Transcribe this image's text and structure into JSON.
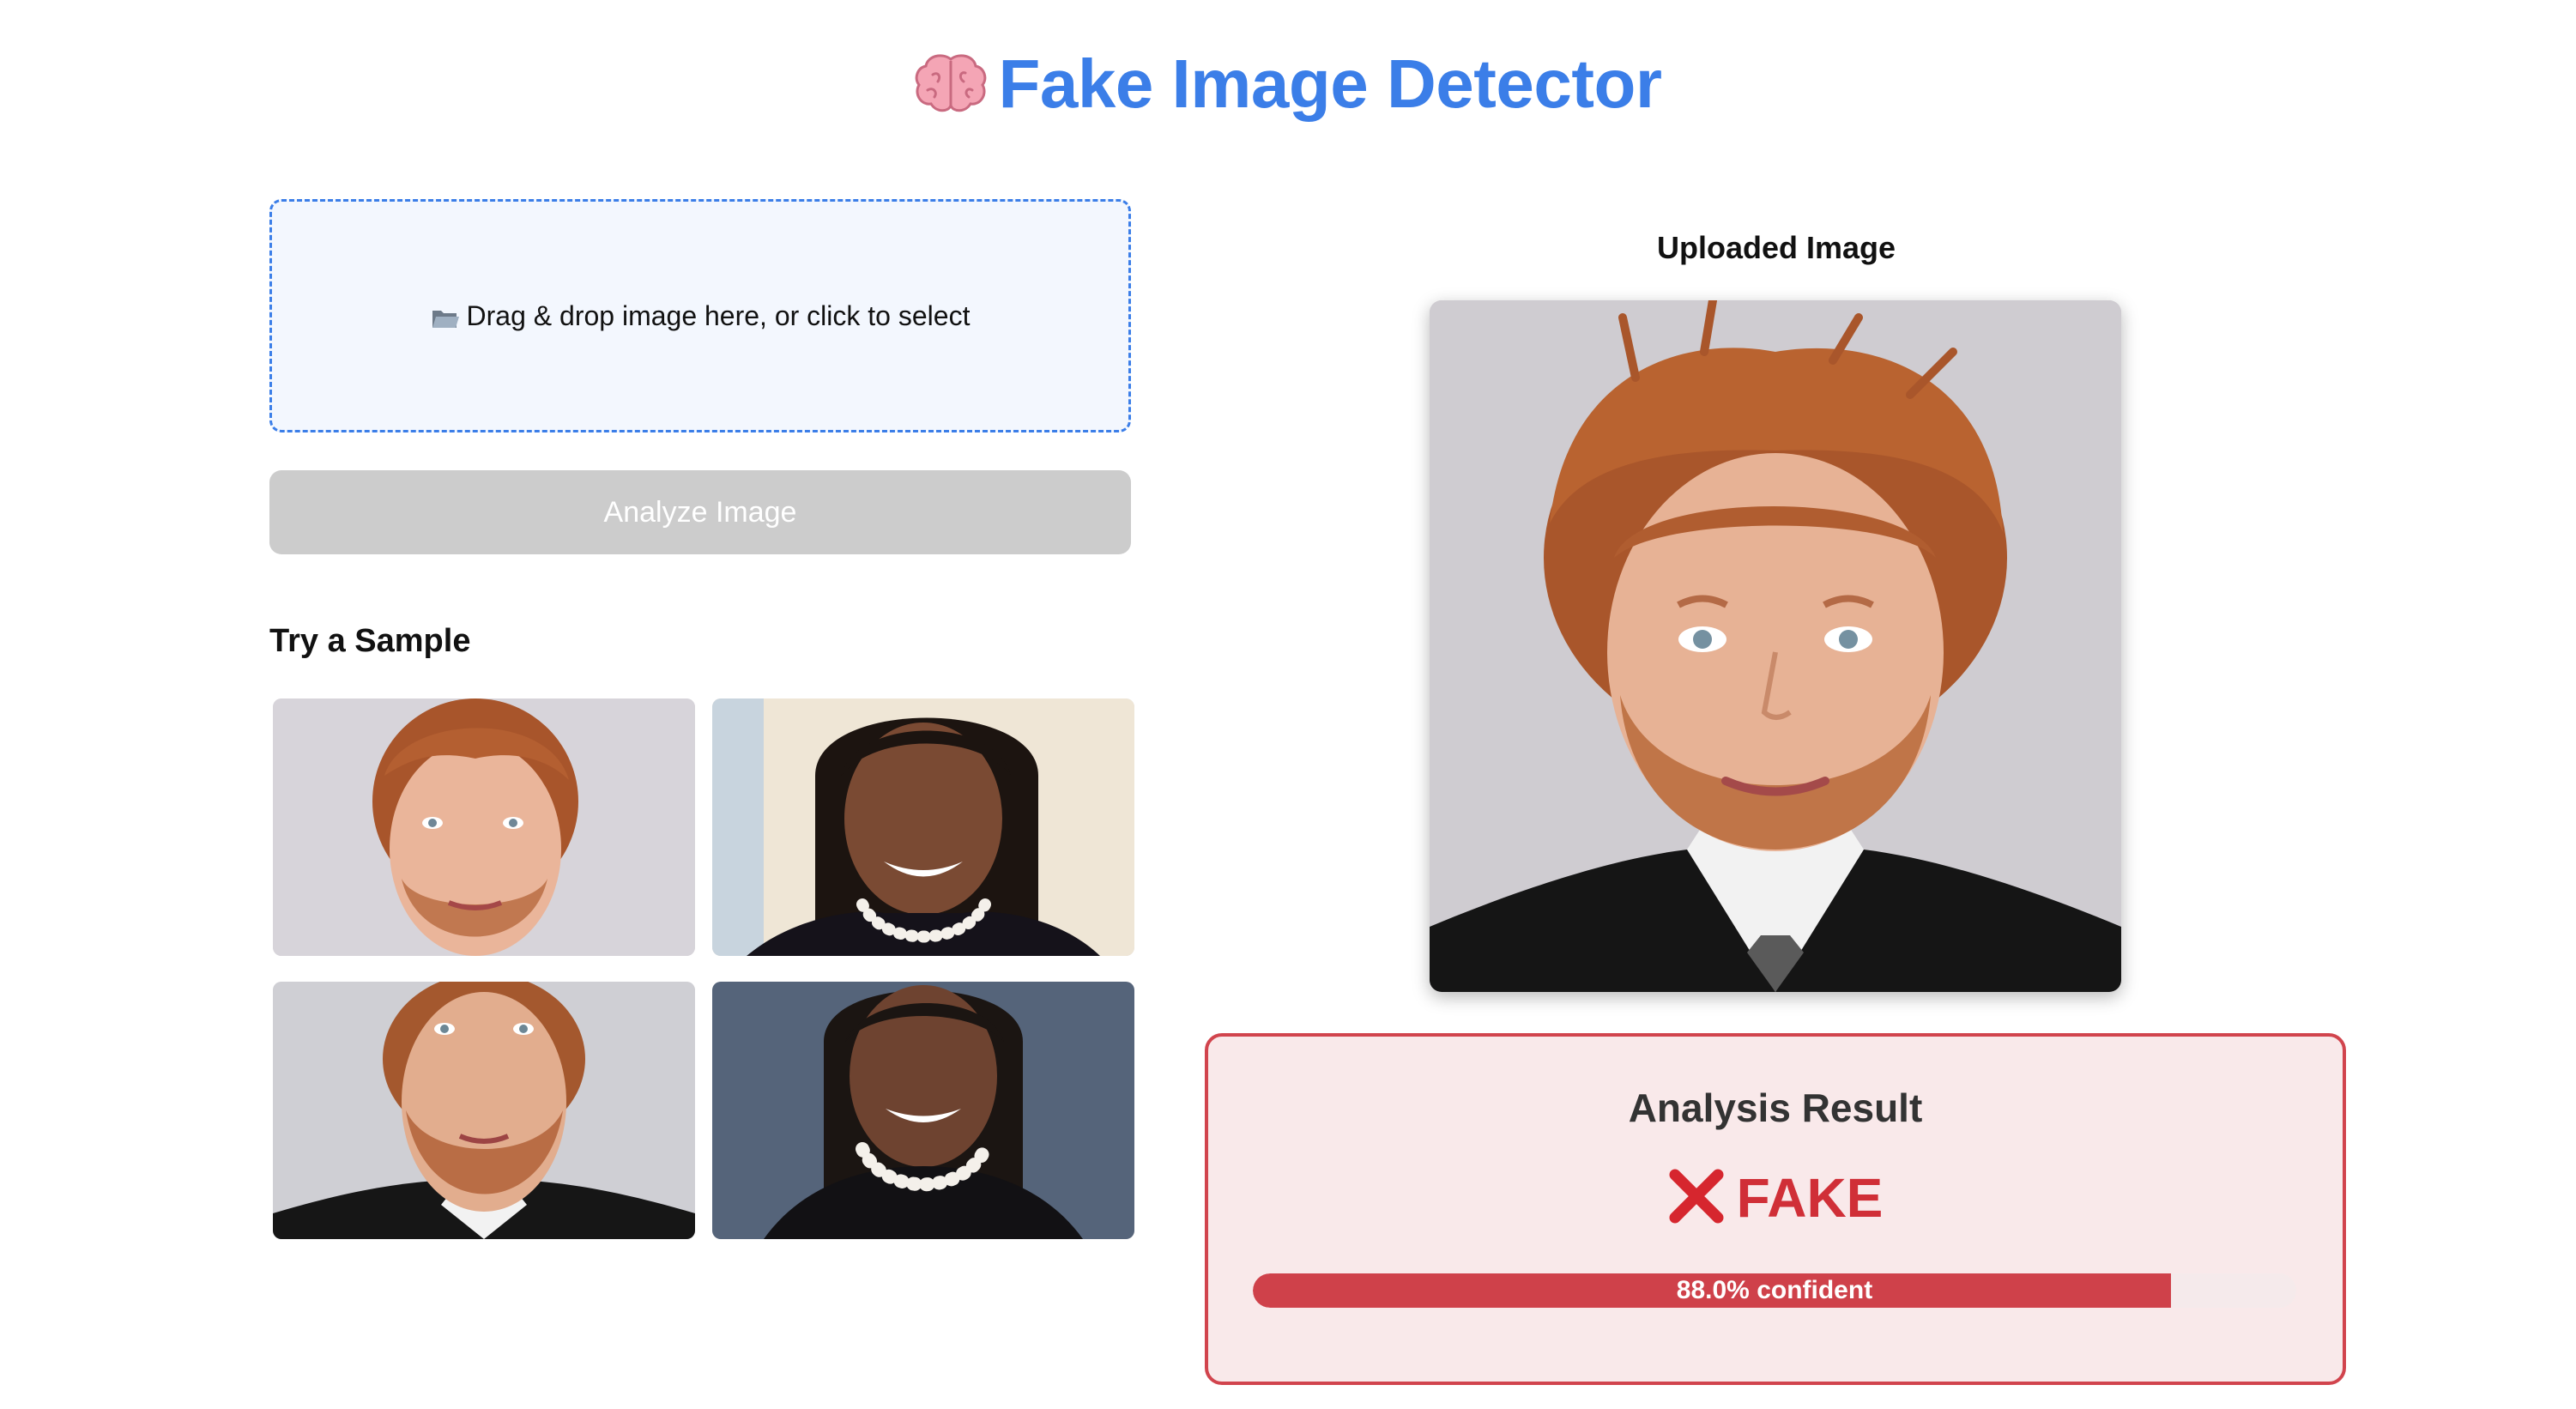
{
  "app": {
    "title_icon": "brain-icon",
    "title": "Fake Image Detector"
  },
  "upload": {
    "dropzone_icon": "folder-icon",
    "dropzone_text": "Drag & drop image here, or click to select",
    "analyze_label": "Analyze Image",
    "analyze_enabled": false
  },
  "samples": {
    "heading": "Try a Sample",
    "items": [
      {
        "subject": "red-haired man portrait",
        "background": "#d7d4da"
      },
      {
        "subject": "woman with pearl necklace portrait",
        "background": "#efe6d6"
      },
      {
        "subject": "red-haired man in suit portrait",
        "background": "#cfcfd4"
      },
      {
        "subject": "woman with pearl necklace portrait",
        "background": "#55647a"
      }
    ]
  },
  "preview": {
    "heading": "Uploaded Image",
    "subject": "red-haired man in suit portrait"
  },
  "result": {
    "title": "Analysis Result",
    "verdict_icon": "cross-mark-icon",
    "verdict": "FAKE",
    "confidence": 0.88,
    "confidence_label": "88.0% confident",
    "colors": {
      "accent": "#d02f37",
      "border": "#d1444d",
      "background": "#f9e9ea"
    }
  },
  "colors": {
    "brand": "#3b7ee8",
    "disabled_button": "#cccccc"
  }
}
